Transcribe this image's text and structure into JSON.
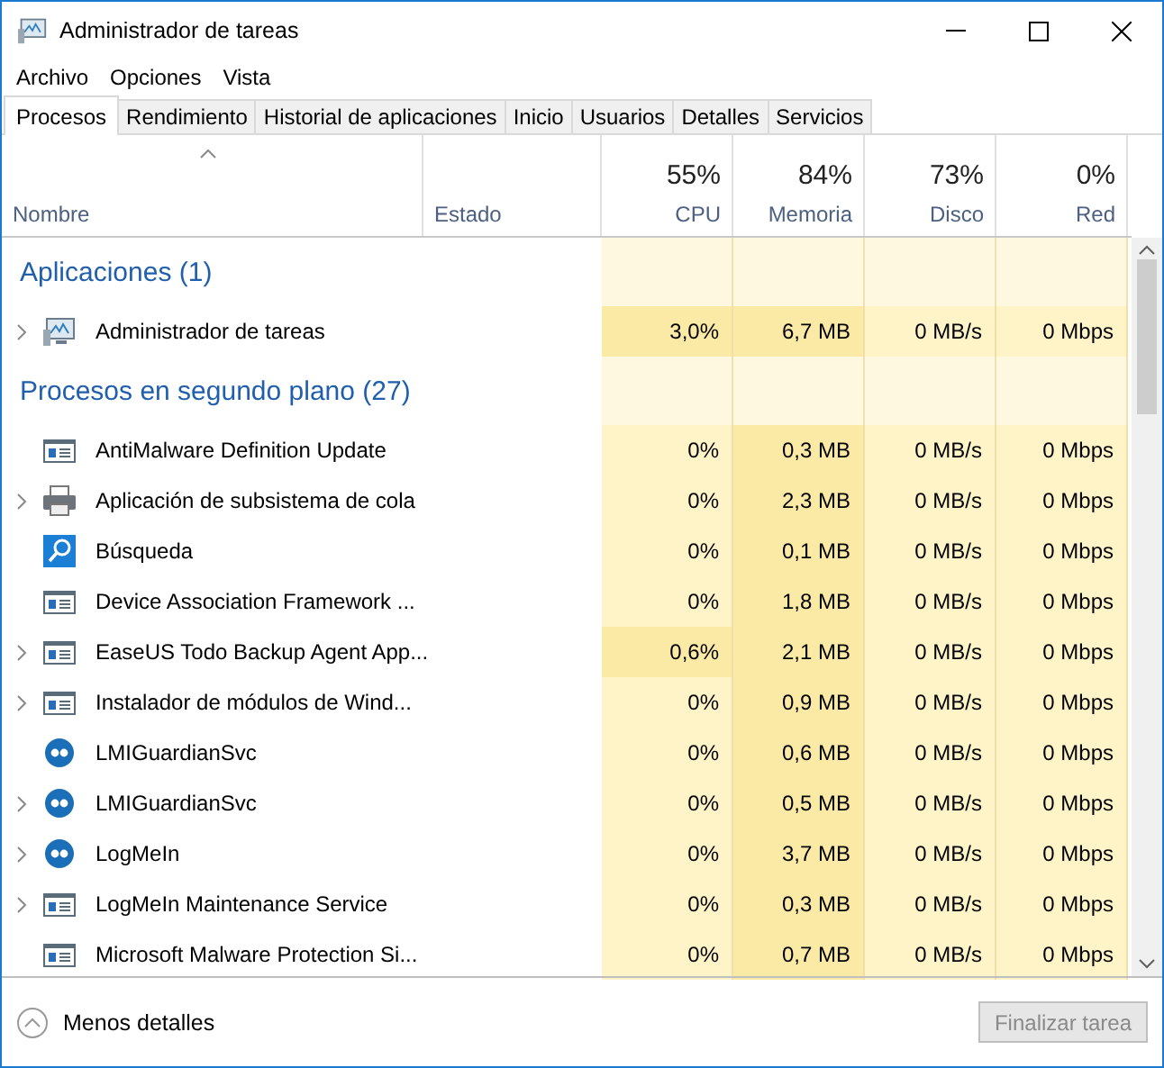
{
  "window": {
    "title": "Administrador de tareas"
  },
  "menu": [
    "Archivo",
    "Opciones",
    "Vista"
  ],
  "tabs": [
    {
      "label": "Procesos",
      "selected": true
    },
    {
      "label": "Rendimiento",
      "selected": false
    },
    {
      "label": "Historial de aplicaciones",
      "selected": false
    },
    {
      "label": "Inicio",
      "selected": false
    },
    {
      "label": "Usuarios",
      "selected": false
    },
    {
      "label": "Detalles",
      "selected": false
    },
    {
      "label": "Servicios",
      "selected": false
    }
  ],
  "table": {
    "columns": [
      {
        "label": "Nombre"
      },
      {
        "label": "Estado"
      },
      {
        "label": "CPU",
        "total": "55%"
      },
      {
        "label": "Memoria",
        "total": "84%"
      },
      {
        "label": "Disco",
        "total": "73%"
      },
      {
        "label": "Red",
        "total": "0%"
      }
    ],
    "rows": [
      {
        "kind": "group",
        "label": "Aplicaciones (1)"
      },
      {
        "kind": "monitor",
        "expandable": true,
        "name": "Administrador de tareas",
        "cells": [
          {
            "text": "3,0%",
            "highlighted": true
          },
          {
            "text": "6,7 MB",
            "highlighted": true
          },
          {
            "text": "0 MB/s",
            "highlighted": false
          },
          {
            "text": "0 Mbps",
            "highlighted": false
          }
        ]
      },
      {
        "kind": "group",
        "label": "Procesos en segundo plano (27)"
      },
      {
        "kind": "window",
        "expandable": false,
        "name": "AntiMalware Definition Update",
        "cells": [
          {
            "text": "0%",
            "highlighted": false
          },
          {
            "text": "0,3 MB",
            "highlighted": true
          },
          {
            "text": "0 MB/s",
            "highlighted": false
          },
          {
            "text": "0 Mbps",
            "highlighted": false
          }
        ]
      },
      {
        "kind": "printer",
        "expandable": true,
        "name": "Aplicación de subsistema de cola",
        "cells": [
          {
            "text": "0%",
            "highlighted": false
          },
          {
            "text": "2,3 MB",
            "highlighted": true
          },
          {
            "text": "0 MB/s",
            "highlighted": false
          },
          {
            "text": "0 Mbps",
            "highlighted": false
          }
        ]
      },
      {
        "kind": "search",
        "expandable": false,
        "name": "Búsqueda",
        "cells": [
          {
            "text": "0%",
            "highlighted": false
          },
          {
            "text": "0,1 MB",
            "highlighted": true
          },
          {
            "text": "0 MB/s",
            "highlighted": false
          },
          {
            "text": "0 Mbps",
            "highlighted": false
          }
        ]
      },
      {
        "kind": "window",
        "expandable": false,
        "name": "Device Association Framework ...",
        "cells": [
          {
            "text": "0%",
            "highlighted": false
          },
          {
            "text": "1,8 MB",
            "highlighted": true
          },
          {
            "text": "0 MB/s",
            "highlighted": false
          },
          {
            "text": "0 Mbps",
            "highlighted": false
          }
        ]
      },
      {
        "kind": "window",
        "expandable": true,
        "name": "EaseUS Todo Backup Agent App...",
        "cells": [
          {
            "text": "0,6%",
            "highlighted": true
          },
          {
            "text": "2,1 MB",
            "highlighted": true
          },
          {
            "text": "0 MB/s",
            "highlighted": false
          },
          {
            "text": "0 Mbps",
            "highlighted": false
          }
        ]
      },
      {
        "kind": "window",
        "expandable": true,
        "name": "Instalador de módulos de Wind...",
        "cells": [
          {
            "text": "0%",
            "highlighted": false
          },
          {
            "text": "0,9 MB",
            "highlighted": true
          },
          {
            "text": "0 MB/s",
            "highlighted": false
          },
          {
            "text": "0 Mbps",
            "highlighted": false
          }
        ]
      },
      {
        "kind": "service",
        "expandable": false,
        "name": "LMIGuardianSvc",
        "cells": [
          {
            "text": "0%",
            "highlighted": false
          },
          {
            "text": "0,6 MB",
            "highlighted": true
          },
          {
            "text": "0 MB/s",
            "highlighted": false
          },
          {
            "text": "0 Mbps",
            "highlighted": false
          }
        ]
      },
      {
        "kind": "service",
        "expandable": true,
        "name": "LMIGuardianSvc",
        "cells": [
          {
            "text": "0%",
            "highlighted": false
          },
          {
            "text": "0,5 MB",
            "highlighted": true
          },
          {
            "text": "0 MB/s",
            "highlighted": false
          },
          {
            "text": "0 Mbps",
            "highlighted": false
          }
        ]
      },
      {
        "kind": "service",
        "expandable": true,
        "name": "LogMeIn",
        "cells": [
          {
            "text": "0%",
            "highlighted": false
          },
          {
            "text": "3,7 MB",
            "highlighted": true
          },
          {
            "text": "0 MB/s",
            "highlighted": false
          },
          {
            "text": "0 Mbps",
            "highlighted": false
          }
        ]
      },
      {
        "kind": "window",
        "expandable": true,
        "name": "LogMeIn Maintenance Service",
        "cells": [
          {
            "text": "0%",
            "highlighted": false
          },
          {
            "text": "0,3 MB",
            "highlighted": true
          },
          {
            "text": "0 MB/s",
            "highlighted": false
          },
          {
            "text": "0 Mbps",
            "highlighted": false
          }
        ]
      },
      {
        "kind": "window",
        "expandable": false,
        "name": "Microsoft Malware Protection Si...",
        "cells": [
          {
            "text": "0%",
            "highlighted": false
          },
          {
            "text": "0,7 MB",
            "highlighted": true
          },
          {
            "text": "0 MB/s",
            "highlighted": false
          },
          {
            "text": "0 Mbps",
            "highlighted": false
          }
        ]
      }
    ]
  },
  "footer": {
    "details_link": "Menos detalles",
    "end_task_button": {
      "label": "Finalizar tarea",
      "disabled": true
    }
  }
}
